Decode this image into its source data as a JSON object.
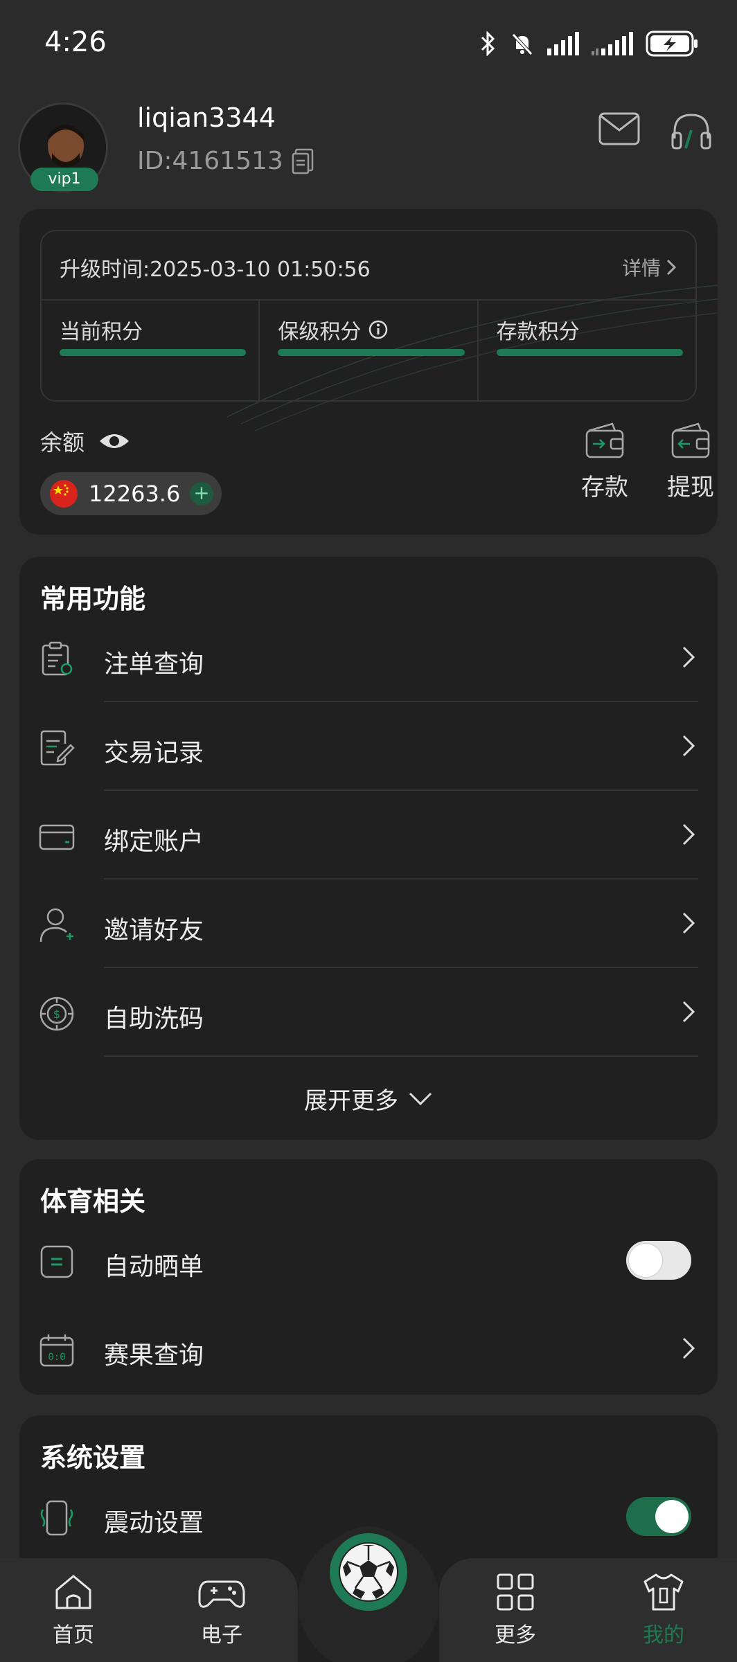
{
  "status_bar": {
    "time": "4:26"
  },
  "profile": {
    "username": "liqian3344",
    "user_id": "ID:4161513",
    "vip": "vip1"
  },
  "account": {
    "upgrade_time": "升级时间:2025-03-10 01:50:56",
    "details": "详情",
    "points": [
      {
        "label": "当前积分"
      },
      {
        "label": "保级积分"
      },
      {
        "label": "存款积分"
      }
    ],
    "balance_label": "余额",
    "balance": "12263.6",
    "deposit": "存款",
    "withdraw": "提现"
  },
  "common": {
    "title": "常用功能",
    "items": [
      {
        "label": "注单查询"
      },
      {
        "label": "交易记录"
      },
      {
        "label": "绑定账户"
      },
      {
        "label": "邀请好友"
      },
      {
        "label": "自助洗码"
      }
    ],
    "expand": "展开更多"
  },
  "sports": {
    "title": "体育相关",
    "auto_share": "自动晒单",
    "auto_share_on": false,
    "results": "赛果查询"
  },
  "system": {
    "title": "系统设置",
    "vibration": "震动设置",
    "vibration_on": true
  },
  "tabbar": {
    "home": "首页",
    "games": "电子",
    "more": "更多",
    "mine": "我的"
  },
  "colors": {
    "accent": "#1e7a54",
    "background": "#2b2b2b",
    "card": "#202020"
  }
}
